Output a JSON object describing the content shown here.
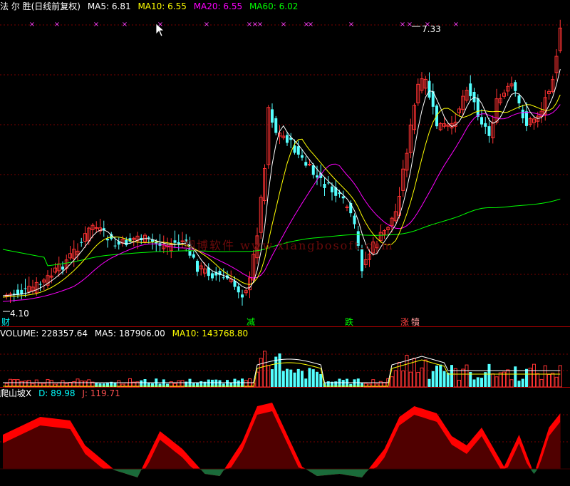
{
  "header": {
    "title": "法 尔 胜(日线前复权)",
    "ma5": "MA5: 6.81",
    "ma10": "MA10: 6.55",
    "ma20": "MA20: 6.55",
    "ma60": "MA60: 6.02"
  },
  "volume_header": {
    "volume": "VOLUME: 228357.64",
    "ma5": "MA5: 187906.00",
    "ma10": "MA10: 143768.80"
  },
  "indicator_header": {
    "name": "爬山坡X",
    "d": "D: 89.98",
    "j": "J: 119.71"
  },
  "annotations": {
    "high_label": "7.33",
    "low_label": "4.10",
    "signal_1": "财",
    "signal_2": "减",
    "signal_3": "跌",
    "signal_4": "涨",
    "signal_5": "犢"
  },
  "watermark": "翔博软件 www.xiangbosoft.com",
  "colors": {
    "up": "#ff3232",
    "down": "#54ffff",
    "ma5": "#ffffff",
    "ma10": "#ffff00",
    "ma20": "#ff00ff",
    "ma60": "#00ff00",
    "indicator_up": "#ff0000",
    "indicator_fill": "#500000",
    "indicator_neg": "#1a6b3a"
  },
  "chart_data": [
    {
      "type": "candlestick",
      "title": "法 尔 胜(日线前复权)",
      "ylim": [
        4.1,
        7.33
      ],
      "series_names": [
        "MA5",
        "MA10",
        "MA20",
        "MA60"
      ],
      "high": 7.33,
      "low": 4.1
    },
    {
      "type": "bar",
      "title": "VOLUME",
      "series_names": [
        "VOLUME",
        "MA5",
        "MA10"
      ],
      "last_values": [
        228357.64,
        187906.0,
        143768.8
      ]
    },
    {
      "type": "area",
      "title": "爬山坡X",
      "series_names": [
        "D",
        "J"
      ],
      "last_values": [
        89.98,
        119.71
      ]
    }
  ]
}
